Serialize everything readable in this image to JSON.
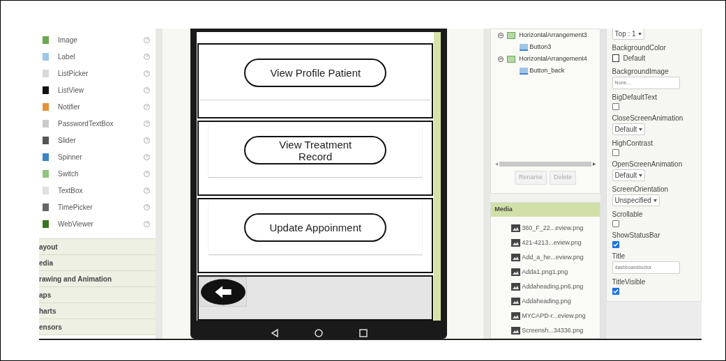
{
  "palette": {
    "items": [
      {
        "label": "Image",
        "help": "?"
      },
      {
        "label": "Label",
        "help": "?"
      },
      {
        "label": "ListPicker",
        "help": "?"
      },
      {
        "label": "ListView",
        "help": "?"
      },
      {
        "label": "Notifier",
        "help": "?"
      },
      {
        "label": "PasswordTextBox",
        "help": "?"
      },
      {
        "label": "Slider",
        "help": "?"
      },
      {
        "label": "Spinner",
        "help": "?"
      },
      {
        "label": "Switch",
        "help": "?"
      },
      {
        "label": "TextBox",
        "help": "?"
      },
      {
        "label": "TimePicker",
        "help": "?"
      },
      {
        "label": "WebViewer",
        "help": "?"
      }
    ],
    "categories": [
      "ayout",
      "edia",
      "rawing and Animation",
      "aps",
      "harts",
      "ensors"
    ]
  },
  "phone": {
    "buttons": [
      "View Profile Patient",
      "View Treatment Record",
      "Update Appoinment"
    ]
  },
  "components": {
    "tree": [
      {
        "label": "HorizontalArrangement3",
        "expanded": true,
        "children": [
          {
            "label": "Button3"
          }
        ]
      },
      {
        "label": "HorizontalArrangement4",
        "expanded": true,
        "children": [
          {
            "label": "Button_back"
          }
        ]
      }
    ],
    "buttons": [
      "Rename",
      "Delete"
    ]
  },
  "media": {
    "title": "Media",
    "files": [
      "360_F_22...eview.png",
      "421-4213...eview.png",
      "Add_a_he...eview.png",
      "Adda1.png1.png",
      "Addaheading.pn6.png",
      "Addaheading.png",
      "MYCAPD-r...eview.png",
      "Screensh...34336.png"
    ]
  },
  "properties": [
    {
      "kind": "dropdown",
      "value": "Top : 1"
    },
    {
      "kind": "color",
      "label": "BackgroundColor",
      "value": "Default"
    },
    {
      "kind": "text",
      "label": "BackgroundImage",
      "value": "None..."
    },
    {
      "kind": "checkbox",
      "label": "BigDefaultText",
      "checked": false
    },
    {
      "kind": "dropdown",
      "label": "CloseScreenAnimation",
      "value": "Default"
    },
    {
      "kind": "checkbox",
      "label": "HighContrast",
      "checked": false
    },
    {
      "kind": "dropdown",
      "label": "OpenScreenAnimation",
      "value": "Default"
    },
    {
      "kind": "dropdown",
      "label": "ScreenOrientation",
      "value": "Unspecified"
    },
    {
      "kind": "checkbox",
      "label": "Scrollable",
      "checked": false
    },
    {
      "kind": "checkbox",
      "label": "ShowStatusBar",
      "checked": true
    },
    {
      "kind": "text",
      "label": "Title",
      "value": "dashboarddoctor"
    },
    {
      "kind": "checkbox",
      "label": "TitleVisible",
      "checked": true
    }
  ]
}
